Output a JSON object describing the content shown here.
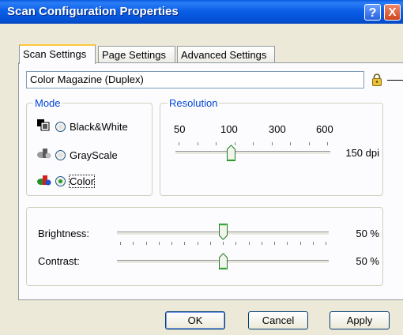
{
  "window": {
    "title": "Scan Configuration Properties",
    "help_glyph": "?",
    "close_glyph": "X"
  },
  "tabs": [
    {
      "label": "Scan Settings",
      "active": true
    },
    {
      "label": "Page Settings",
      "active": false
    },
    {
      "label": "Advanced Settings",
      "active": false
    }
  ],
  "profile": {
    "value": "Color Magazine (Duplex)",
    "locked": true
  },
  "mode": {
    "label": "Mode",
    "options": [
      {
        "label": "Black&White",
        "icon": "black-white-mode-icon",
        "selected": false
      },
      {
        "label": "GrayScale",
        "icon": "grayscale-mode-icon",
        "selected": false
      },
      {
        "label": "Color",
        "icon": "color-mode-icon",
        "selected": true
      }
    ]
  },
  "resolution": {
    "label": "Resolution",
    "ticks": [
      "50",
      "100",
      "300",
      "600"
    ],
    "value_text": "150 dpi",
    "value_fraction": 0.36
  },
  "adjustments": {
    "brightness": {
      "label": "Brightness:",
      "value_text": "50 %",
      "value_fraction": 0.5
    },
    "contrast": {
      "label": "Contrast:",
      "value_text": "50 %",
      "value_fraction": 0.5
    }
  },
  "buttons": {
    "ok": "OK",
    "cancel": "Cancel",
    "apply": "Apply"
  },
  "colors": {
    "title_bar": "#0553d8",
    "group_label": "#0046d5",
    "tab_highlight": "#ffc83c",
    "dialog_bg": "#ece9d8"
  }
}
